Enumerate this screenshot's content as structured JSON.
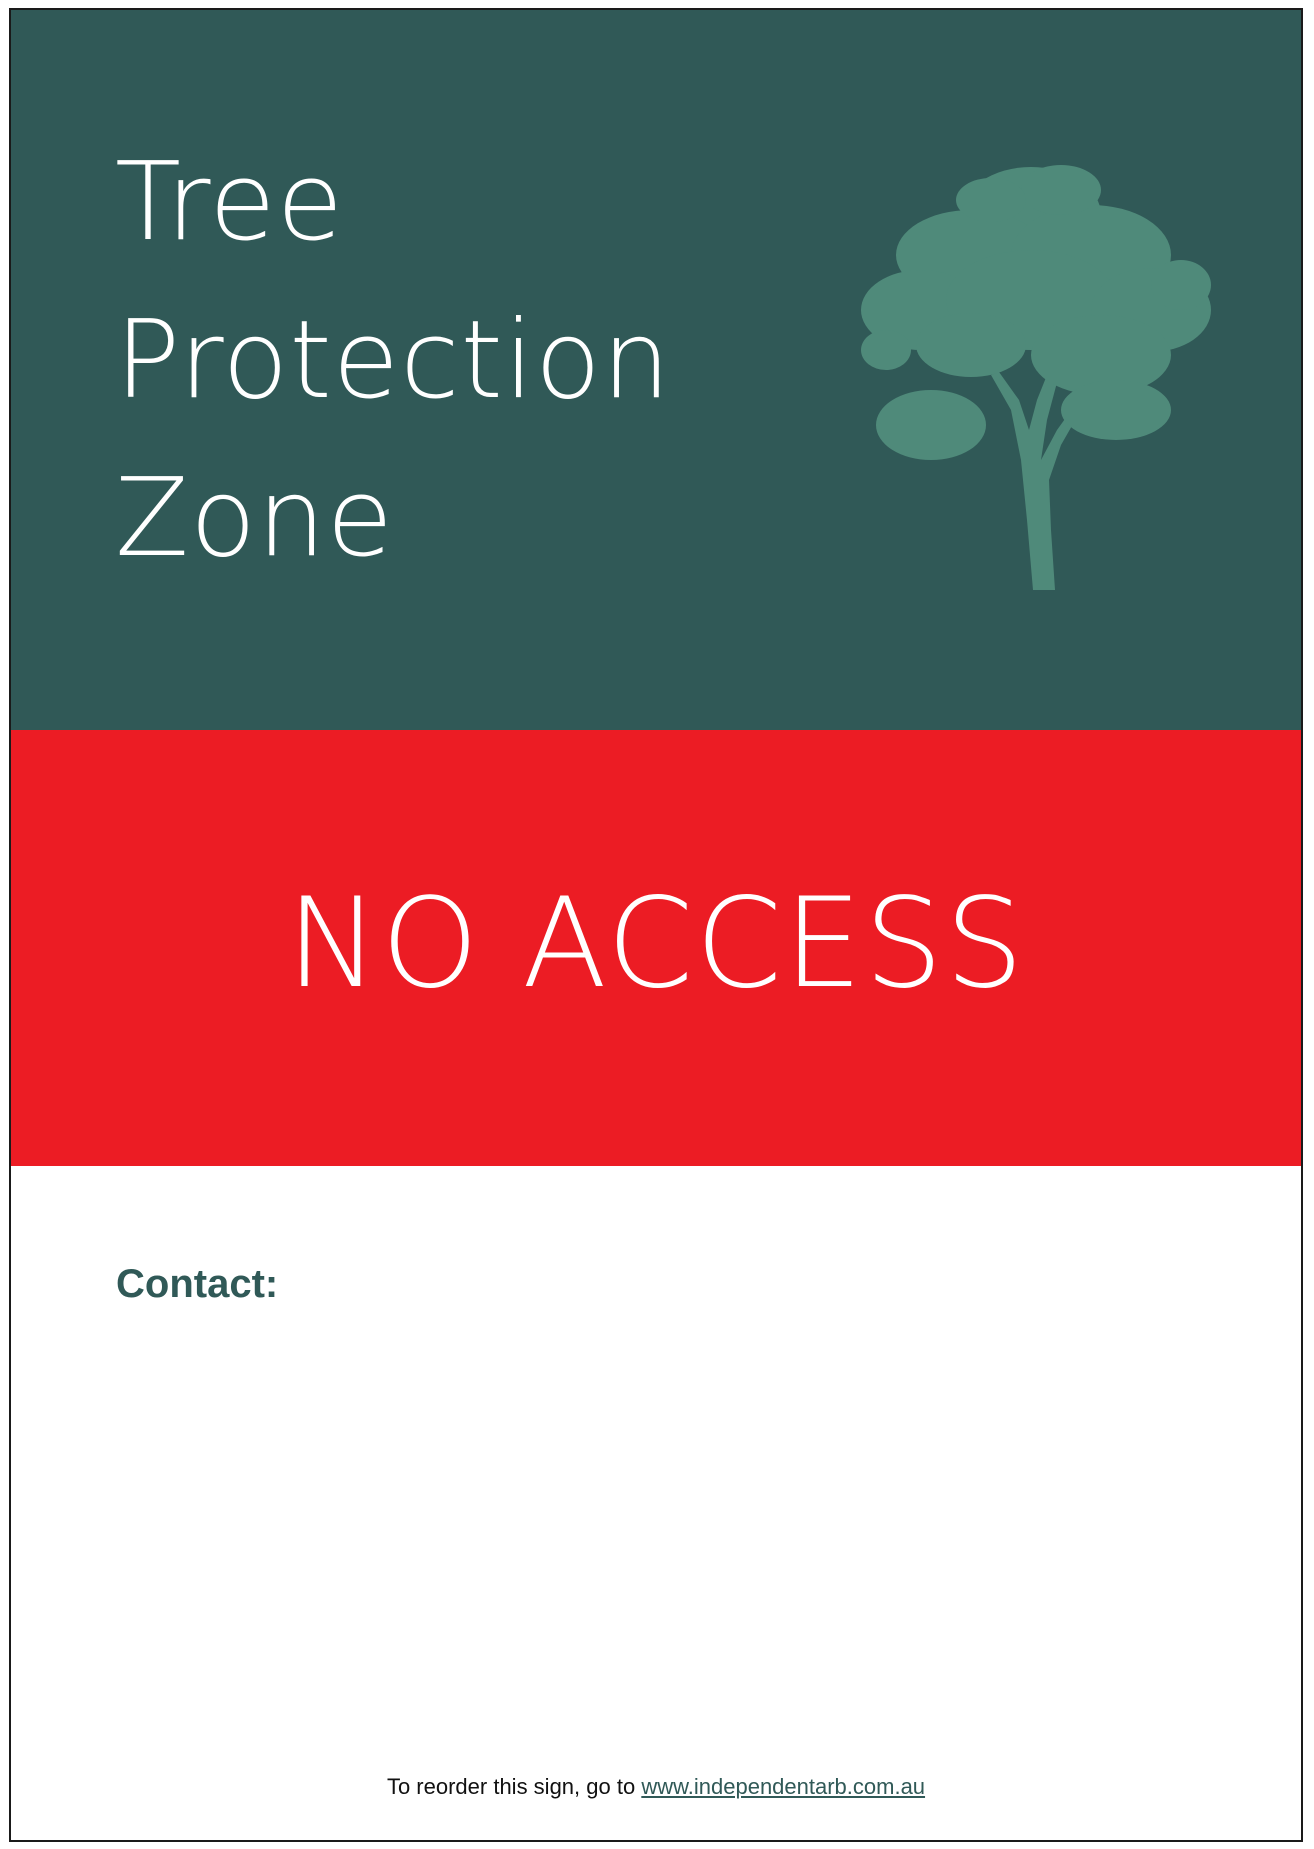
{
  "sign": {
    "title_lines": [
      "Tree",
      "Protection",
      "Zone"
    ],
    "icon": "tree-icon",
    "warning": "NO ACCESS",
    "contact_label": "Contact:",
    "footer_text": "To reorder this sign, go to",
    "footer_link": "www.independentarb.com.au"
  },
  "colors": {
    "header_bg": "#305957",
    "warning_bg": "#ec1c24",
    "tree": "#4f8a7a",
    "text_light": "#ffffff",
    "contact_text": "#305957"
  }
}
